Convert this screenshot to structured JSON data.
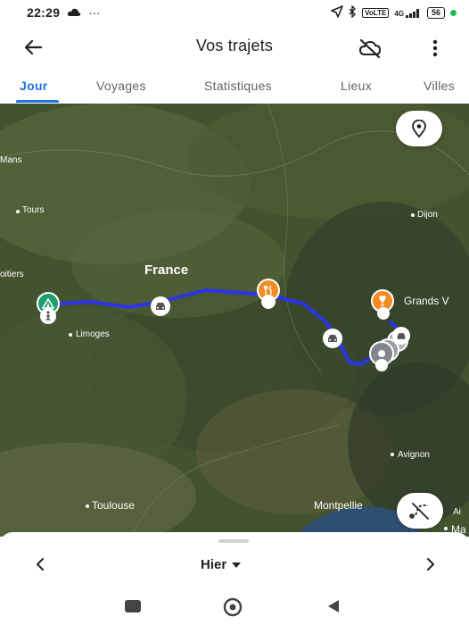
{
  "status_bar": {
    "time": "22:29",
    "cloud_icon": "cloud-icon",
    "ellipsis": "···",
    "net_label": "4G",
    "battery": "56"
  },
  "app_bar": {
    "title": "Vos trajets"
  },
  "tabs": [
    {
      "label": "Jour",
      "active": true
    },
    {
      "label": "Voyages",
      "active": false
    },
    {
      "label": "Statistiques",
      "active": false
    },
    {
      "label": "Lieux",
      "active": false
    },
    {
      "label": "Villes",
      "active": false
    }
  ],
  "map": {
    "labels": {
      "mans": "Mans",
      "tours": "Tours",
      "dijon": "Dijon",
      "poitiers": "oitiers",
      "france": "France",
      "limoges": "Limoges",
      "grands": "Grands V",
      "toulouse": "Toulouse",
      "montpellier": "Montpellie",
      "avignon": "Avignon",
      "ai": "Ai",
      "ma": "Ma"
    },
    "route_color": "#2a34e8",
    "accent_orange": "#f28b22",
    "accent_green": "#1e9e6e"
  },
  "bottom_sheet": {
    "day_label": "Hier"
  }
}
